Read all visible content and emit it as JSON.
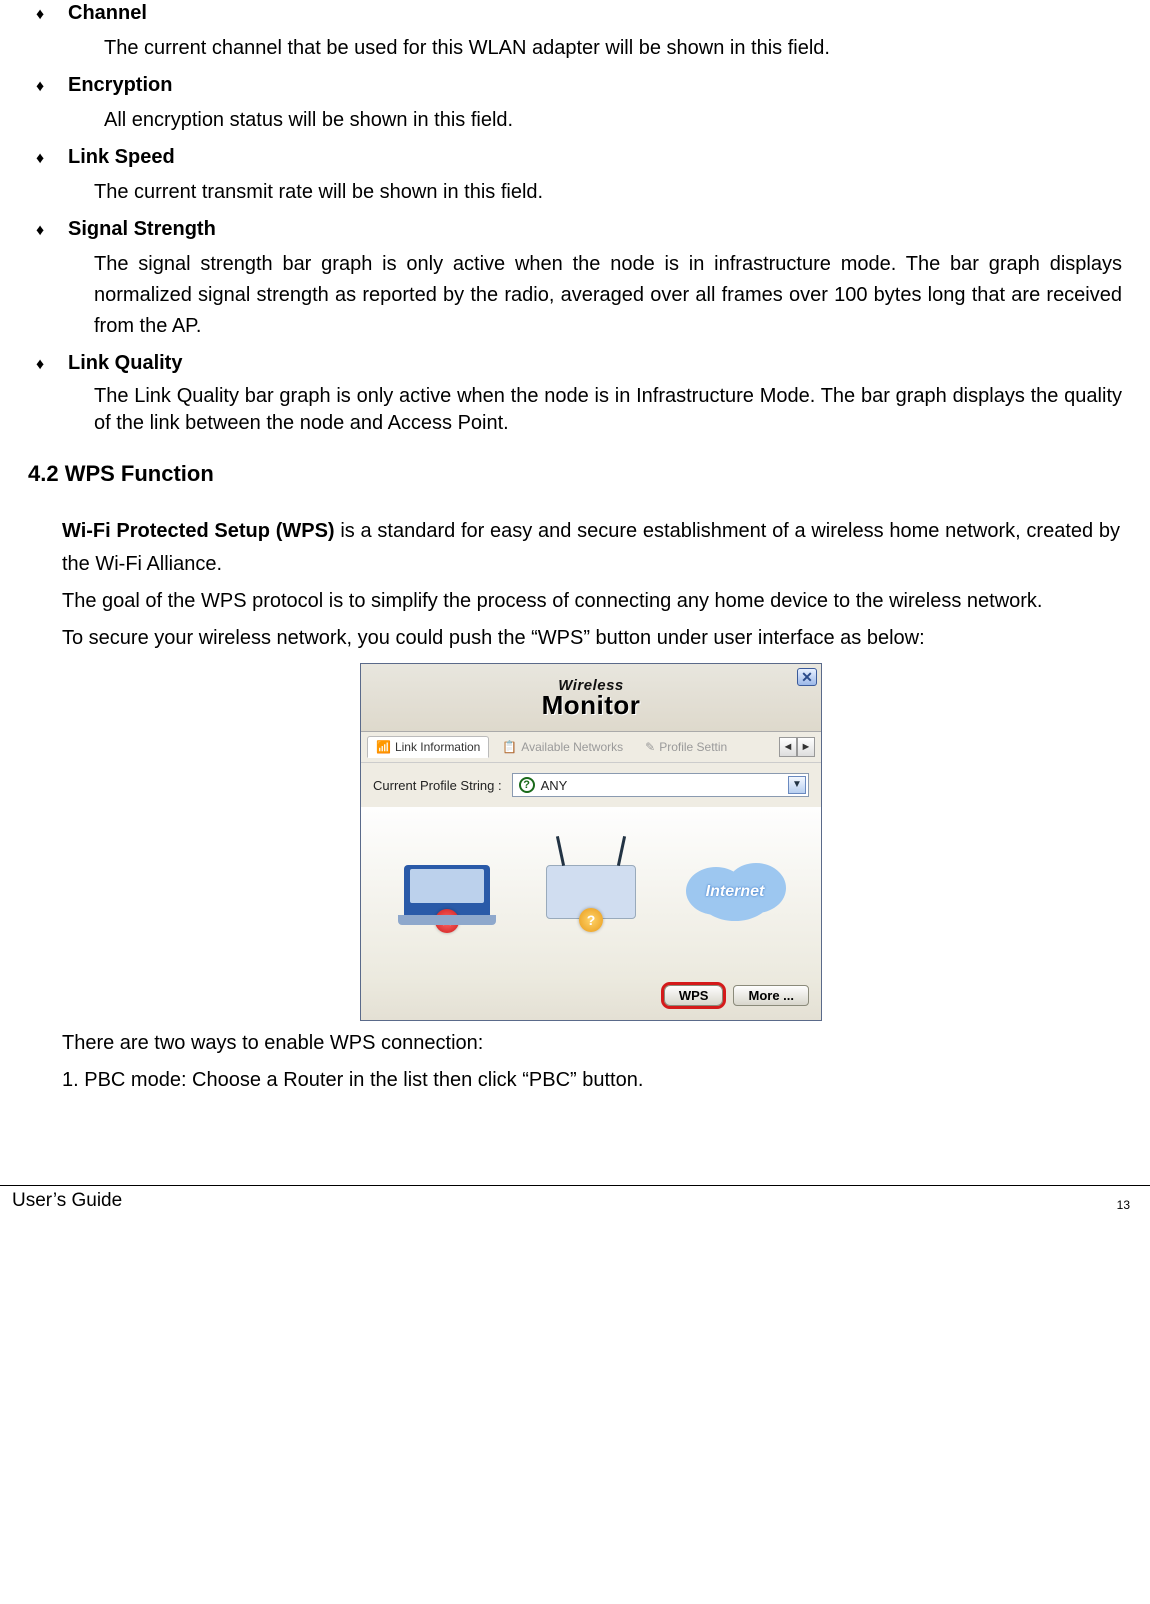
{
  "items": [
    {
      "title": "Channel",
      "desc": "The current channel that be used for this WLAN adapter will be shown in this field.",
      "indent": "extra"
    },
    {
      "title": "Encryption",
      "desc": "All encryption status will be shown in this field.",
      "indent": "extra"
    },
    {
      "title": "Link Speed",
      "desc": "The current transmit rate will be shown in this field."
    },
    {
      "title": "Signal Strength",
      "desc": "The signal strength bar graph is only active when the node is in infrastructure mode. The bar graph displays normalized signal strength as reported by the radio, averaged over all frames over 100 bytes long that are received from the AP."
    },
    {
      "title": "Link Quality",
      "desc": "The Link Quality bar graph is only active when the node is in Infrastructure Mode.  The bar graph displays the quality of the link between the node and Access Point.",
      "tight": true
    }
  ],
  "section_heading": "4.2 WPS Function",
  "wps_bold": "Wi-Fi Protected Setup (WPS)",
  "wps_p1_rest": " is a standard for easy and secure establishment of a wireless home network, created by the Wi-Fi Alliance.",
  "wps_p2": "The goal of the WPS protocol is to simplify the process of connecting any home device to the wireless network.",
  "wps_p3": "To secure your wireless network, you could push the “WPS” button under user interface as below:",
  "after1": "There are two ways to enable WPS connection:",
  "after2": "1. PBC mode: Choose a Router in the list then click “PBC” button.",
  "monitor": {
    "logo_top": "Wireless",
    "logo_bottom": "Monitor",
    "tab1": "Link Information",
    "tab2": "Available Networks",
    "tab3": "Profile Settin",
    "profile_label": "Current Profile String :",
    "profile_value": "ANY",
    "cloud_label": "Internet",
    "wps_btn": "WPS",
    "more_btn": "More ..."
  },
  "footer_left": "User’s Guide",
  "footer_page": "13"
}
